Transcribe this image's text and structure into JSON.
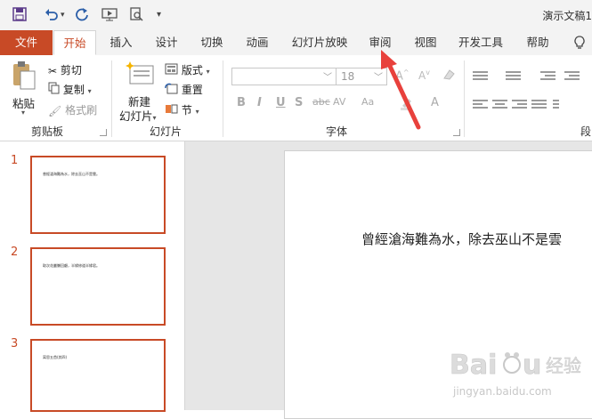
{
  "qat": {
    "icons": [
      "save-icon",
      "undo-icon",
      "redo-icon",
      "start-from-beginning-icon",
      "print-preview-icon",
      "customize-qat-icon"
    ],
    "title": "演示文稿1"
  },
  "tabs": {
    "file": "文件",
    "home": "开始",
    "insert": "插入",
    "design": "设计",
    "transitions": "切换",
    "animations": "动画",
    "slideshow": "幻灯片放映",
    "review": "审阅",
    "view": "视图",
    "developer": "开发工具",
    "help": "帮助",
    "tell_me_icon": "lightbulb-icon"
  },
  "clipboard": {
    "label": "剪贴板",
    "paste": "粘贴",
    "cut": "剪切",
    "copy": "复制",
    "format_painter": "格式刷"
  },
  "slides_group": {
    "label": "幻灯片",
    "new_slide_line1": "新建",
    "new_slide_line2": "幻灯片",
    "layout": "版式",
    "reset": "重置",
    "section": "节"
  },
  "font_group": {
    "label": "字体",
    "font_size": "18",
    "format_buttons": [
      "B",
      "I",
      "U",
      "S",
      "abc",
      "AV",
      "Aa",
      "A"
    ]
  },
  "paragraph_group": {
    "label": "段"
  },
  "slides": [
    {
      "number": "1",
      "text": "曾經滄海難為水，除去巫山不是雲。"
    },
    {
      "number": "2",
      "text": "取次花叢懶回顧，半緣修道半緣君。"
    },
    {
      "number": "3",
      "text": "离思五首(其四)"
    }
  ],
  "main_slide": {
    "text": "曾經滄海難為水，除去巫山不是雲"
  },
  "watermark": {
    "brand": "Baidu 经验",
    "url": "jingyan.baidu.com"
  },
  "colors": {
    "accent": "#c84a26",
    "annotation_arrow": "#e8413c"
  }
}
